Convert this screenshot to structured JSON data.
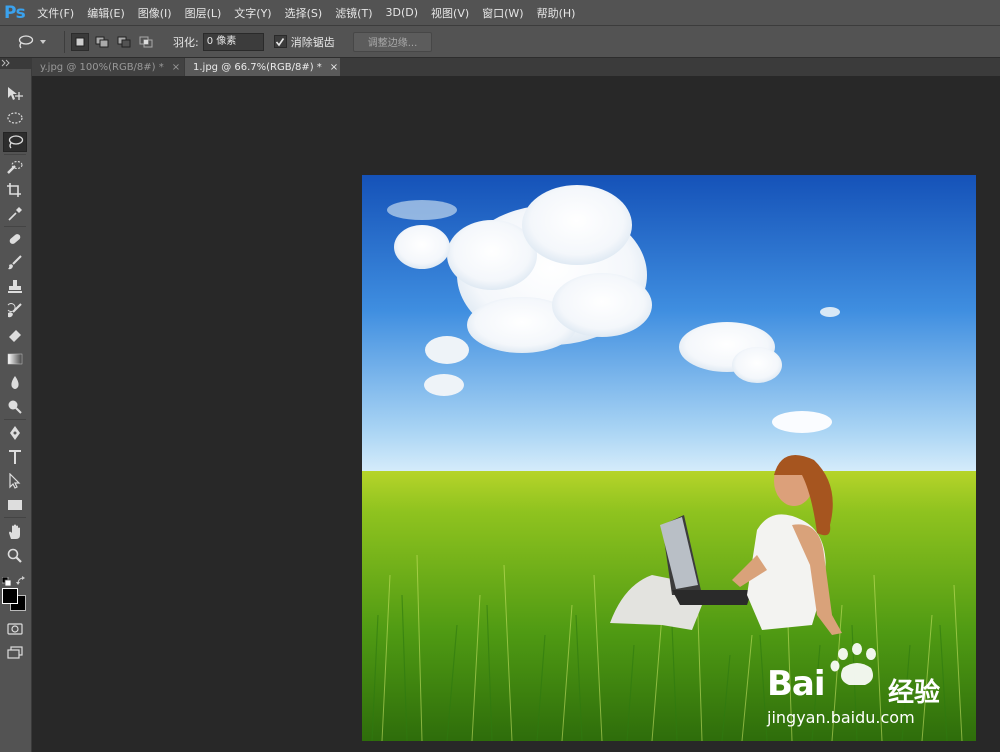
{
  "app": {
    "logo": "Ps"
  },
  "menu": [
    "文件(F)",
    "编辑(E)",
    "图像(I)",
    "图层(L)",
    "文字(Y)",
    "选择(S)",
    "滤镜(T)",
    "3D(D)",
    "视图(V)",
    "窗口(W)",
    "帮助(H)"
  ],
  "options": {
    "feather_label": "羽化:",
    "feather_value": "0 像素",
    "anti_alias_label": "消除锯齿",
    "anti_alias_checked": true,
    "refine_edge_label": "调整边缘..."
  },
  "tabs": [
    {
      "label": "y.jpg @ 100%(RGB/8#) *",
      "active": false
    },
    {
      "label": "1.jpg @ 66.7%(RGB/8#) *",
      "active": true
    }
  ],
  "tab_close_glyph": "×",
  "watermark": {
    "brand": "Bai",
    "brand_suffix": "经验",
    "url": "jingyan.baidu.com"
  },
  "colors": {
    "ui_bg": "#535353",
    "canvas_bg": "#282828",
    "ps_blue": "#3aa2ee"
  }
}
